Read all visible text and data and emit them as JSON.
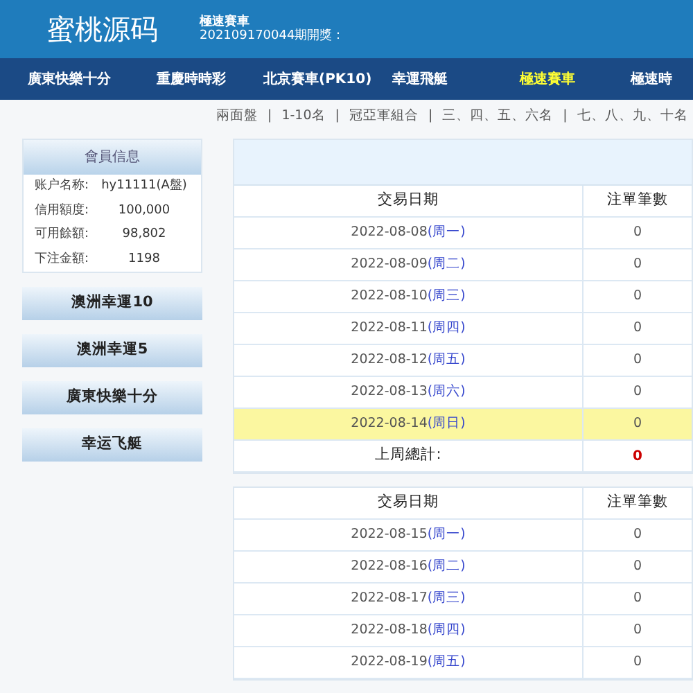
{
  "header": {
    "logo": "蜜桃源码",
    "game_title": "極速賽車",
    "draw_info": "202109170044期開獎："
  },
  "nav": [
    {
      "label": "廣東快樂十分",
      "selected": false
    },
    {
      "label": "重慶時時彩",
      "selected": false
    },
    {
      "label": "北京賽車(PK10)",
      "selected": false
    },
    {
      "label": "幸運飛艇",
      "selected": false
    },
    {
      "label": "極速賽車",
      "selected": true
    },
    {
      "label": "極速時",
      "selected": false
    }
  ],
  "subnav": {
    "separator": "|",
    "items": [
      "兩面盤",
      "1-10名",
      "冠亞軍組合",
      "三、四、五、六名",
      "七、八、九、十名"
    ]
  },
  "member_info": {
    "title": "會員信息",
    "rows": [
      {
        "label": "账户名称:",
        "value": "hy11111(A盤)"
      },
      {
        "label": "信用額度:",
        "value": "100,000"
      },
      {
        "label": "可用餘額:",
        "value": "98,802"
      },
      {
        "label": "下注金額:",
        "value": "1198"
      }
    ]
  },
  "side_buttons": [
    "澳洲幸運10",
    "澳洲幸運5",
    "廣東快樂十分",
    "幸运飞艇"
  ],
  "tables": [
    {
      "columns": [
        "交易日期",
        "注單筆數"
      ],
      "banner": true,
      "rows": [
        {
          "date": "2022-08-08",
          "weekday": "(周一)",
          "count": "0",
          "highlighted": false
        },
        {
          "date": "2022-08-09",
          "weekday": "(周二)",
          "count": "0",
          "highlighted": false
        },
        {
          "date": "2022-08-10",
          "weekday": "(周三)",
          "count": "0",
          "highlighted": false
        },
        {
          "date": "2022-08-11",
          "weekday": "(周四)",
          "count": "0",
          "highlighted": false
        },
        {
          "date": "2022-08-12",
          "weekday": "(周五)",
          "count": "0",
          "highlighted": false
        },
        {
          "date": "2022-08-13",
          "weekday": "(周六)",
          "count": "0",
          "highlighted": false
        },
        {
          "date": "2022-08-14",
          "weekday": "(周日)",
          "count": "0",
          "highlighted": true
        }
      ],
      "total": {
        "label": "上周總計:",
        "value": "0"
      }
    },
    {
      "columns": [
        "交易日期",
        "注單筆數"
      ],
      "banner": false,
      "rows": [
        {
          "date": "2022-08-15",
          "weekday": "(周一)",
          "count": "0",
          "highlighted": false
        },
        {
          "date": "2022-08-16",
          "weekday": "(周二)",
          "count": "0",
          "highlighted": false
        },
        {
          "date": "2022-08-17",
          "weekday": "(周三)",
          "count": "0",
          "highlighted": false
        },
        {
          "date": "2022-08-18",
          "weekday": "(周四)",
          "count": "0",
          "highlighted": false
        },
        {
          "date": "2022-08-19",
          "weekday": "(周五)",
          "count": "0",
          "highlighted": false
        }
      ]
    }
  ]
}
